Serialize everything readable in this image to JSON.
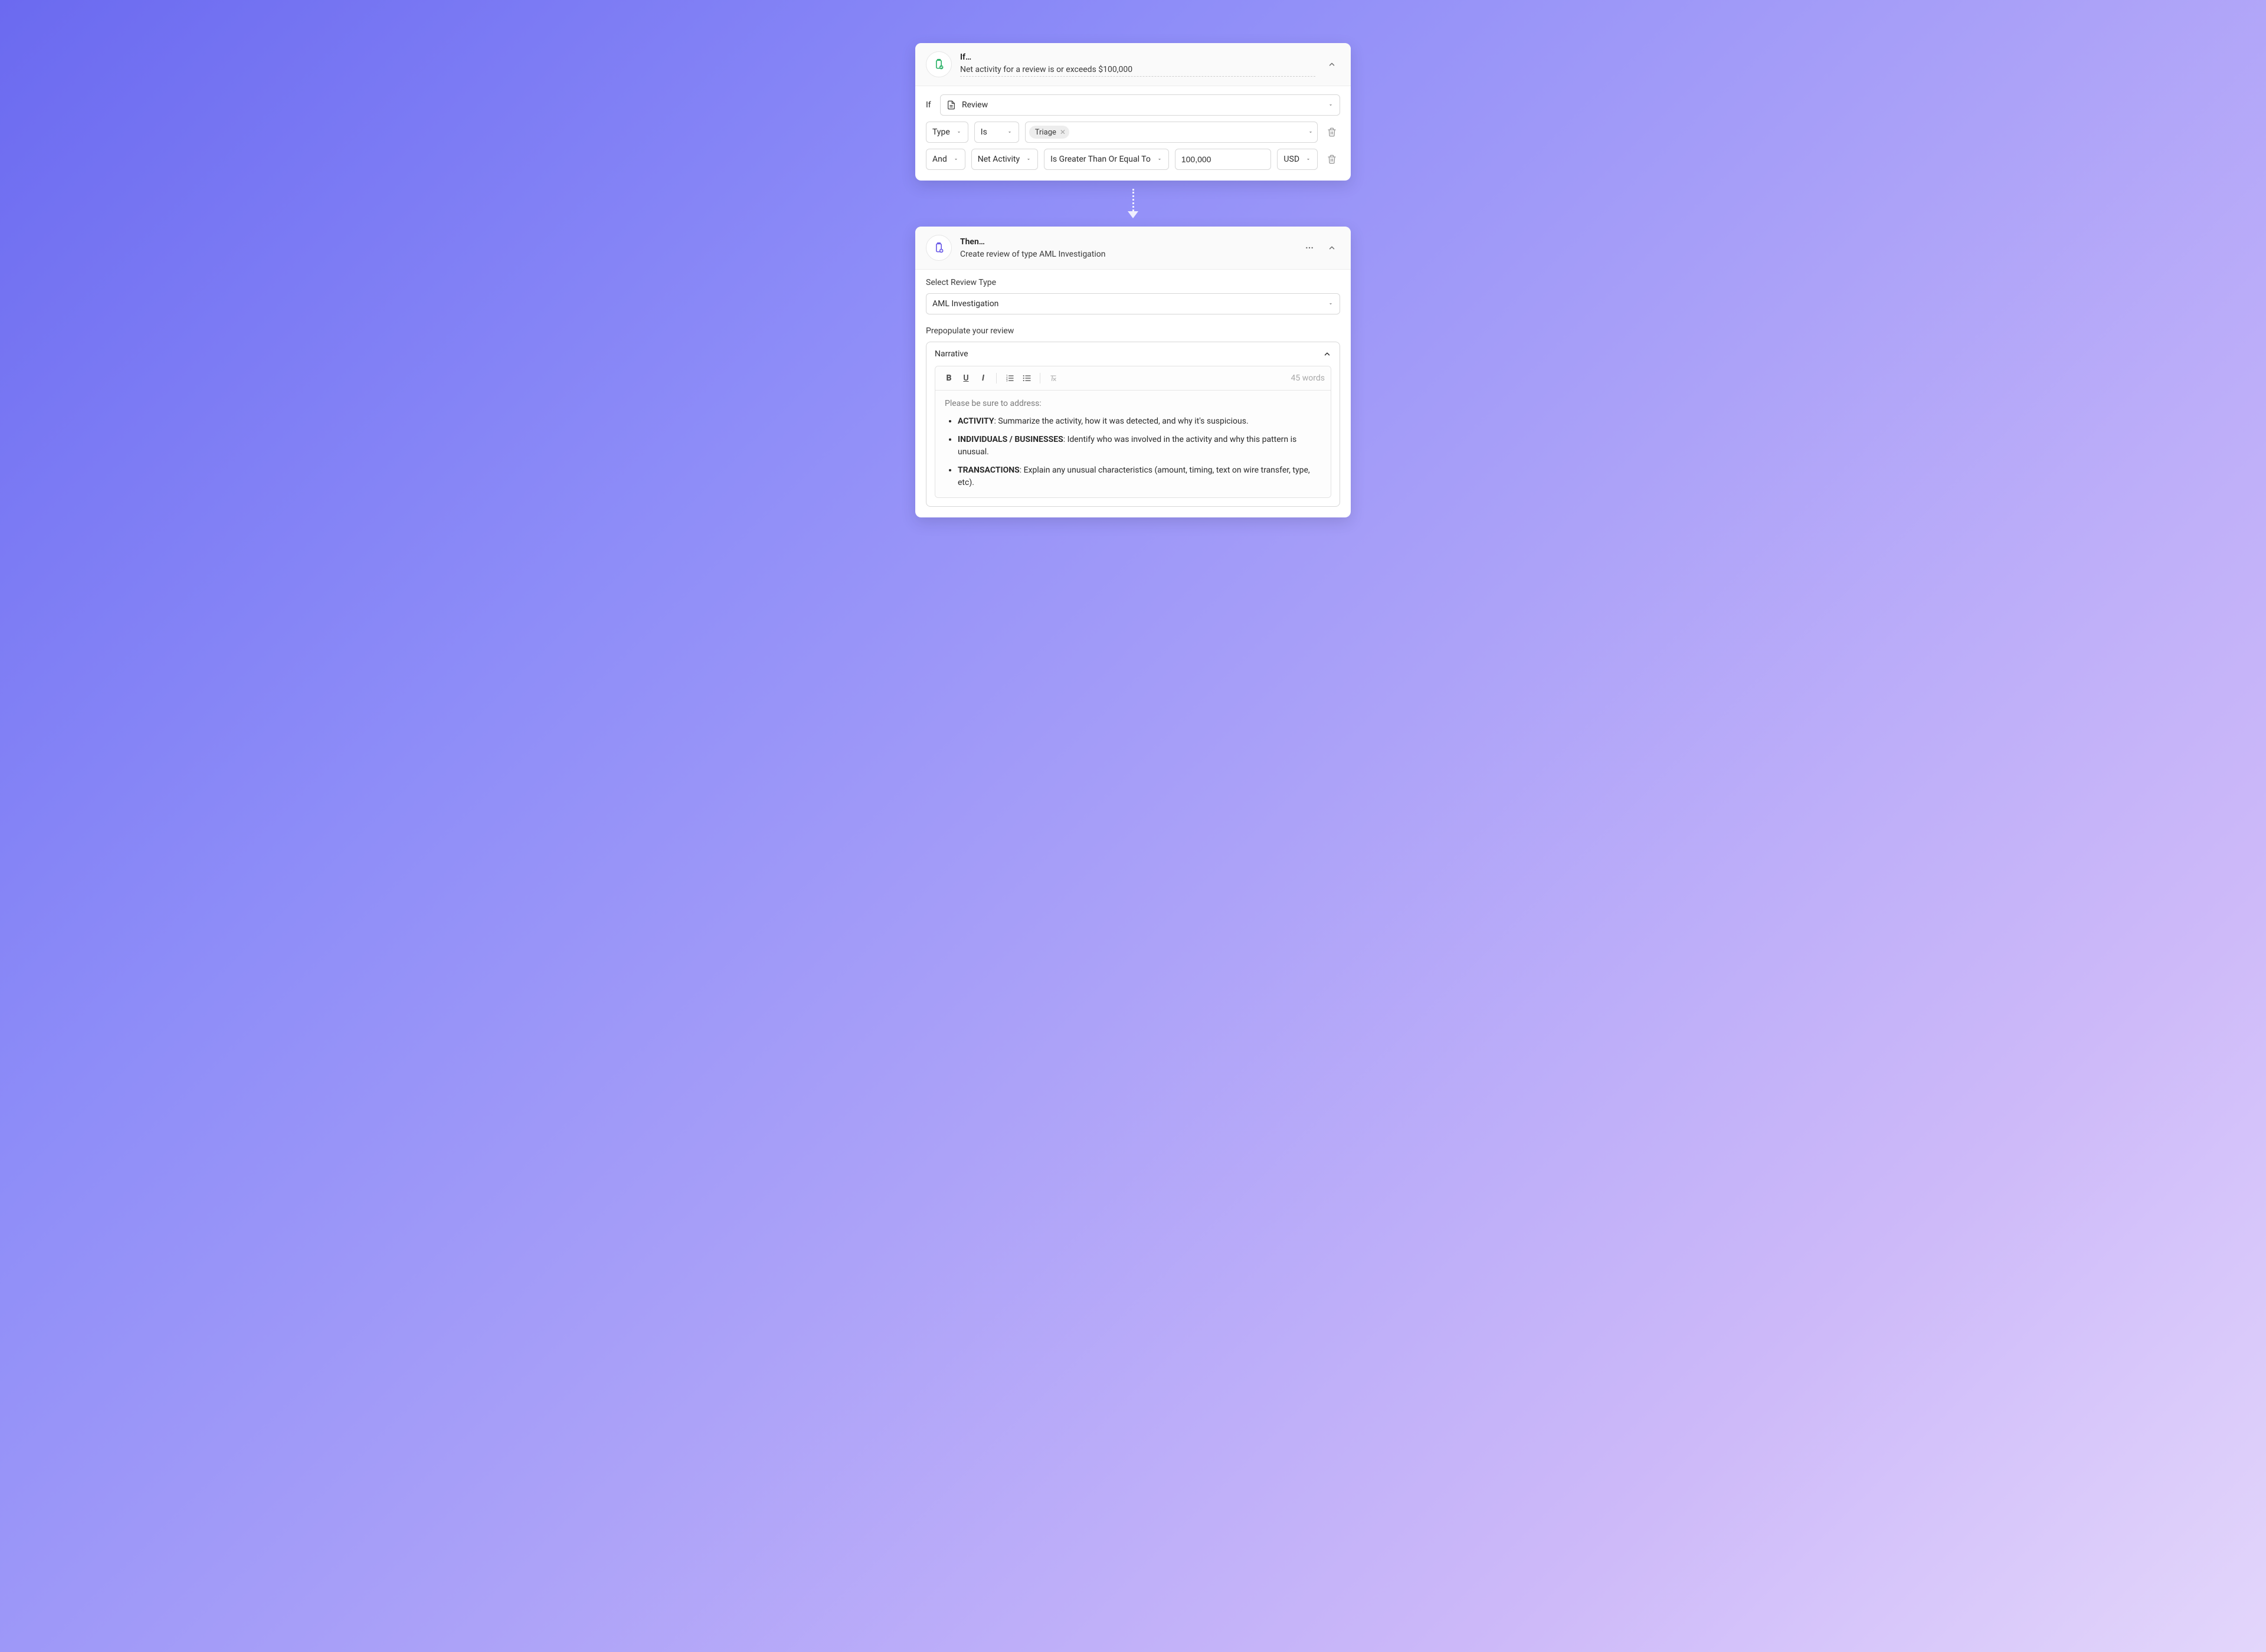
{
  "if_card": {
    "title": "If…",
    "description": "Net activity for a review is or exceeds $100,000",
    "if_label": "If",
    "entity_select": "Review",
    "row1": {
      "field": "Type",
      "operator": "Is",
      "chip": "Triage"
    },
    "row2": {
      "conjunction": "And",
      "field": "Net Activity",
      "operator": "Is Greater Than Or Equal To",
      "value": "100,000",
      "currency": "USD"
    }
  },
  "then_card": {
    "title": "Then…",
    "description": "Create review of type AML Investigation",
    "select_label": "Select Review Type",
    "review_type": "AML Investigation",
    "prepopulate_label": "Prepopulate your review",
    "narrative_label": "Narrative",
    "word_count": "45 words",
    "intro": "Please be sure to address:",
    "bullets": [
      {
        "head": "ACTIVITY",
        "body": ": Summarize the activity, how it was detected, and why it's suspicious."
      },
      {
        "head": "INDIVIDUALS / BUSINESSES",
        "body": ": Identify who was involved in the activity and why this pattern is unusual."
      },
      {
        "head": "TRANSACTIONS",
        "body": ": Explain any unusual characteristics (amount, timing, text on wire transfer, type, etc)."
      }
    ]
  }
}
